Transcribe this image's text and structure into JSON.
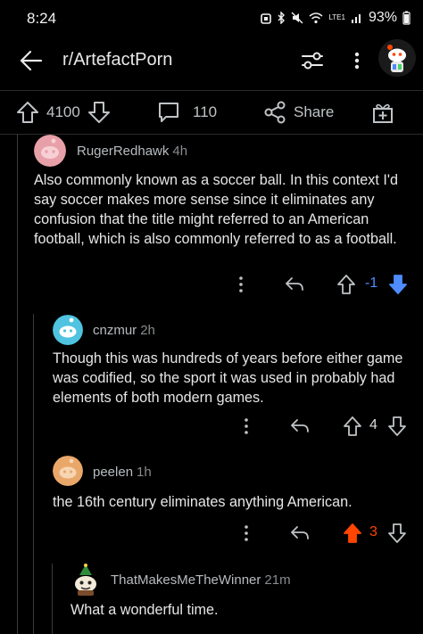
{
  "status": {
    "time": "8:24",
    "battery": "93%",
    "network": "LTE1"
  },
  "header": {
    "subreddit": "r/ArtefactPorn"
  },
  "actions": {
    "upvotes": "4100",
    "comments": "110",
    "share_label": "Share"
  },
  "comments": [
    {
      "author": "RugerRedhawk",
      "age": "4h",
      "body": "Also commonly known as a soccer ball. In this context I'd say soccer makes more sense since it eliminates any confusion that the title might referred to an American football, which is also commonly referred to as a football.",
      "score": "-1",
      "vote_state": "downvoted",
      "avatar_color": "#e8a0a8"
    },
    {
      "author": "cnzmur",
      "age": "2h",
      "body": "Though this was hundreds of years before either game was codified, so the sport it was used in probably had elements of both modern games.",
      "score": "4",
      "vote_state": "none",
      "avatar_color": "#4fc3e0"
    },
    {
      "author": "peelen",
      "age": "1h",
      "body": "the 16th century eliminates anything American.",
      "score": "3",
      "vote_state": "upvoted",
      "avatar_color": "#e9a76a"
    },
    {
      "author": "ThatMakesMeTheWinner",
      "age": "21m",
      "body": "What a wonderful time.",
      "avatar_color": "#1a1a1b"
    }
  ],
  "colors": {
    "upvote": "#ff4500",
    "downvote": "#4e8cff",
    "background": "#000000"
  }
}
